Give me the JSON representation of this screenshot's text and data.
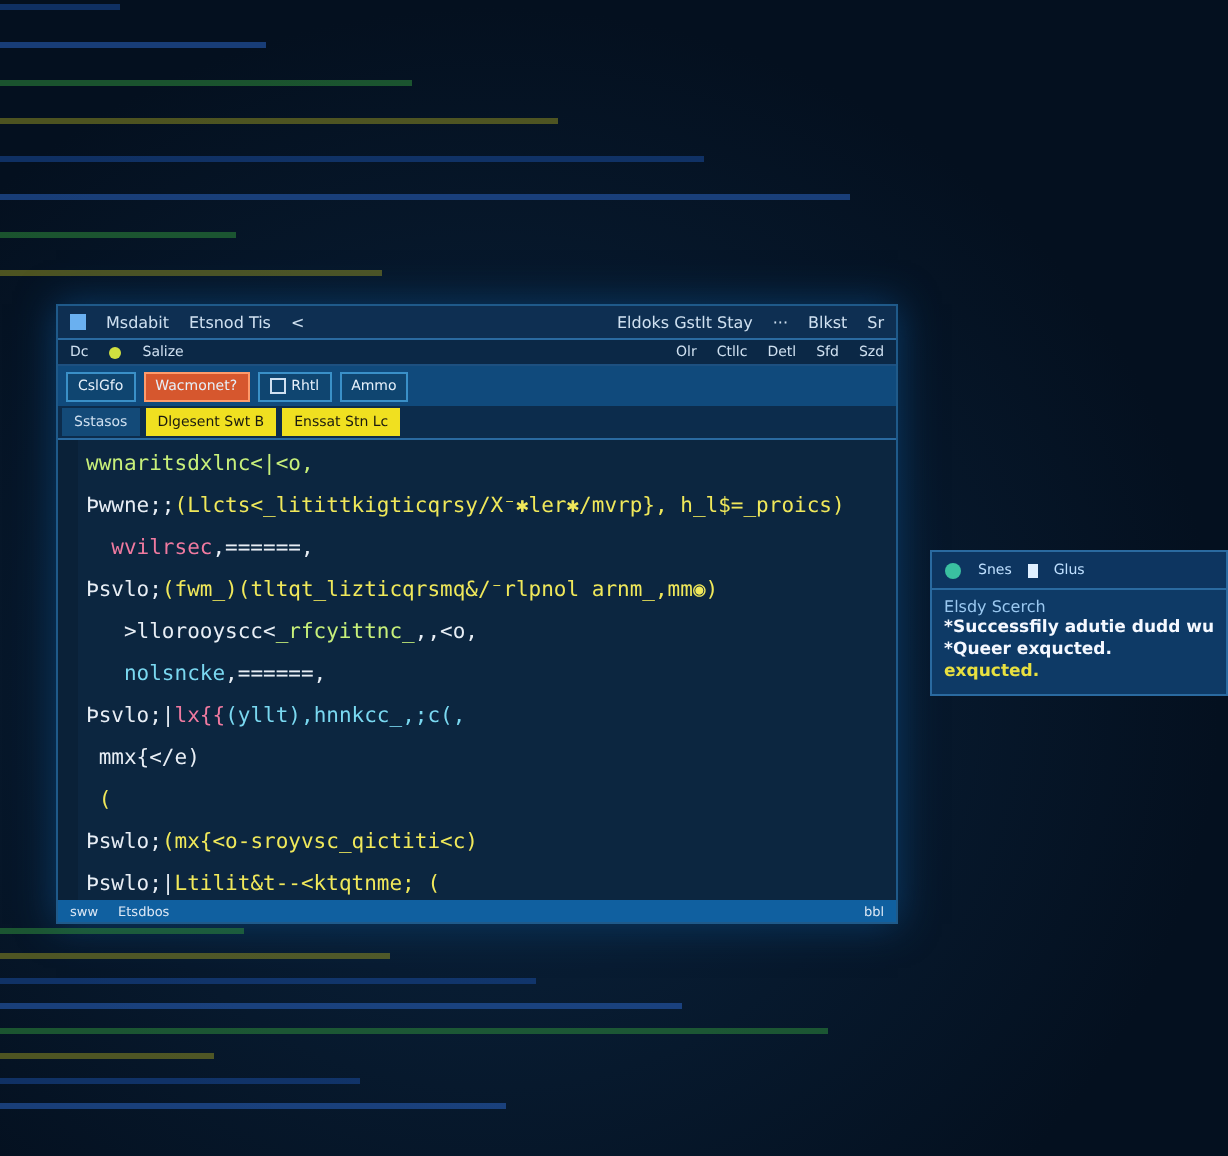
{
  "editor": {
    "title_bar": {
      "app_name": "Msdabit",
      "file_name": "Etsnod Tis",
      "back": "<",
      "right": [
        "Eldoks Gstlt Stay",
        "···",
        "Blkst",
        "Sr"
      ]
    },
    "menu": {
      "left": [
        "Dc",
        "Salize"
      ],
      "right": [
        "Olr",
        "Ctllc",
        "Detl",
        "Sfd",
        "Szd"
      ]
    },
    "toolbar": [
      {
        "kind": "plain",
        "label": "CslGfo"
      },
      {
        "kind": "alert",
        "label": "Wacmonet?"
      },
      {
        "kind": "check",
        "label": "Rhtl",
        "checked": false
      },
      {
        "kind": "plain",
        "label": "Ammo"
      }
    ],
    "tabs": [
      {
        "label": "Sstasos",
        "selected": true
      },
      {
        "label": "Dlgesent  Swt B",
        "selected": false
      },
      {
        "label": "Enssat  Stn Lc",
        "selected": false
      }
    ],
    "code": [
      [
        {
          "kind": "green",
          "text": "wwnaritsdxlnc<|<o,"
        }
      ],
      [
        {
          "kind": "plain",
          "text": "Þwwne;;"
        },
        {
          "kind": "yellow",
          "text": "(Llcts<_litittkigticqrsy/X⁻✱ler✱/mvrp}, h_l$=_proics)"
        }
      ],
      [
        {
          "kind": "pink",
          "text": "  wvilrsec"
        },
        {
          "kind": "plain",
          "text": ",======,"
        }
      ],
      [
        {
          "kind": "plain",
          "text": "Þsvlo;"
        },
        {
          "kind": "yellow",
          "text": "(fwm_)(tltqt_lizticqrsmq&/⁻rlpnol arnm_,mm◉)"
        }
      ],
      [
        {
          "kind": "plain",
          "text": "   >llorooyscc<"
        },
        {
          "kind": "green",
          "text": "_rfcyittnc_"
        },
        {
          "kind": "plain",
          "text": ",,<o,"
        }
      ],
      [
        {
          "kind": "cyan",
          "text": "   nolsncke"
        },
        {
          "kind": "plain",
          "text": ",======,"
        }
      ],
      [
        {
          "kind": "plain",
          "text": "Þsvlo;|"
        },
        {
          "kind": "pink",
          "text": "lx{{"
        },
        {
          "kind": "cyan",
          "text": "(yllt),hnnkcc_,;c(,"
        }
      ],
      [
        {
          "kind": "plain",
          "text": " mmx{</e)"
        }
      ],
      [
        {
          "kind": "yellow",
          "text": " ("
        }
      ],
      [
        {
          "kind": "plain",
          "text": "Þswlo;"
        },
        {
          "kind": "yellow",
          "text": "(mx{<o-sroyvsc_qictiti<c)"
        }
      ],
      [
        {
          "kind": "plain",
          "text": "Þswlo;|"
        },
        {
          "kind": "yellow",
          "text": "Ltilit&t--<ktqtnme; ("
        }
      ]
    ],
    "status_bar": {
      "left": [
        "sww",
        "Etsdbos"
      ],
      "right": "bbl"
    }
  },
  "notification": {
    "header": [
      "Snes",
      "Glus"
    ],
    "title": "Elsdy Scerch",
    "lines": [
      {
        "kind": "plain",
        "text": "*Successfily adutie dudd wu"
      },
      {
        "kind": "plain",
        "text": "*Queer exqucted."
      },
      {
        "kind": "highlight",
        "text": "exqucted."
      }
    ]
  }
}
